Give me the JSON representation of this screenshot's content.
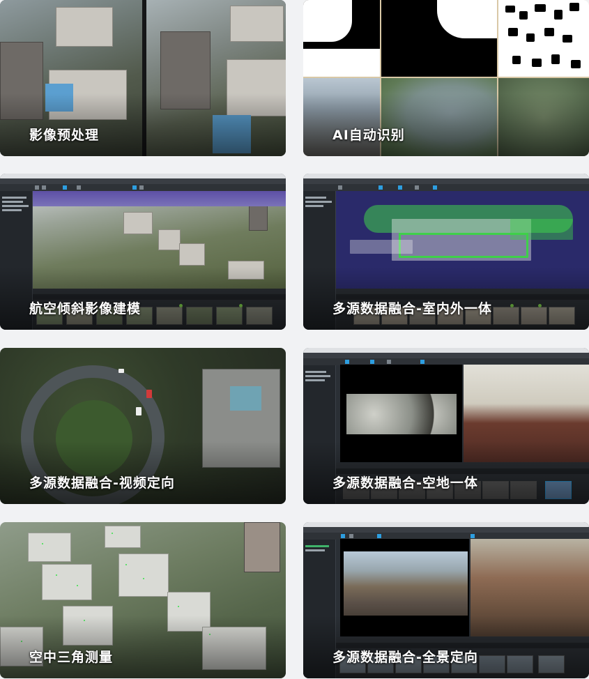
{
  "cards": [
    {
      "id": "preprocessing",
      "label": "影像预处理"
    },
    {
      "id": "ai-recognition",
      "label": "AI自动识别"
    },
    {
      "id": "oblique-modeling",
      "label": "航空倾斜影像建模"
    },
    {
      "id": "indoor-outdoor",
      "label": "多源数据融合-室内外一体"
    },
    {
      "id": "video-orientation",
      "label": "多源数据融合-视频定向"
    },
    {
      "id": "sky-ground",
      "label": "多源数据融合-空地一体"
    },
    {
      "id": "aerial-triangulation",
      "label": "空中三角测量"
    },
    {
      "id": "panorama-orientation",
      "label": "多源数据融合-全景定向"
    }
  ],
  "colors": {
    "accent": "#2d9ee0",
    "point_cloud_green": "#3fd04a",
    "background": "#f1f2f4"
  }
}
